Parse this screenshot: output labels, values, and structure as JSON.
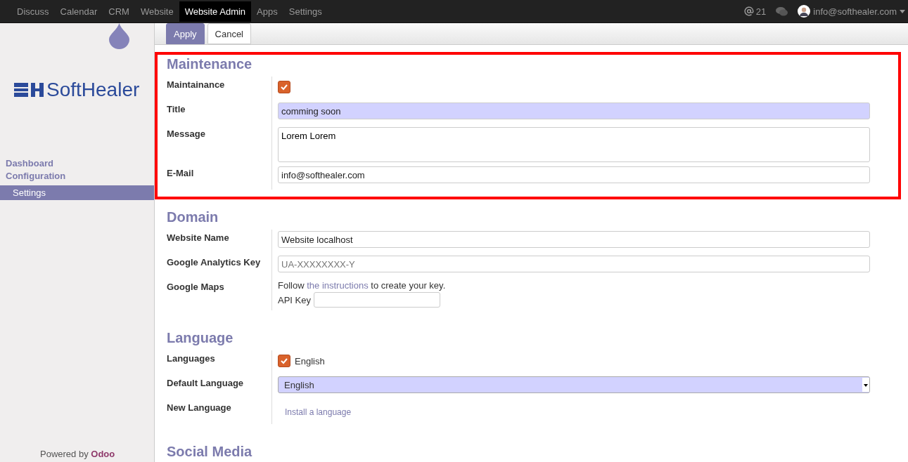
{
  "topbar": {
    "apps": [
      {
        "label": "Discuss",
        "selected": false
      },
      {
        "label": "Calendar",
        "selected": false
      },
      {
        "label": "CRM",
        "selected": false
      },
      {
        "label": "Website",
        "selected": false
      },
      {
        "label": "Website Admin",
        "selected": true
      },
      {
        "label": "Apps",
        "selected": false
      },
      {
        "label": "Settings",
        "selected": false
      }
    ],
    "mentions": "21",
    "user": "info@softhealer.com"
  },
  "sidebar": {
    "logo_text": "SoftHealer",
    "section": [
      "Dashboard",
      "Configuration"
    ],
    "items": [
      {
        "label": "Settings",
        "selected": true
      }
    ],
    "footer": {
      "text": "Powered by",
      "link": "Odoo"
    }
  },
  "toolbar": {
    "buttons": [
      {
        "label": "Apply",
        "kind": "primary"
      },
      {
        "label": "Cancel",
        "kind": "secondary"
      }
    ]
  },
  "sections": [
    {
      "title": "Maintenance",
      "highlighted": true,
      "fields": [
        {
          "label": "Maintainance",
          "kind": "checkbox",
          "checked": true
        },
        {
          "label": "Title",
          "kind": "input",
          "value": "comming soon",
          "required": true
        },
        {
          "label": "Message",
          "kind": "textarea",
          "value": "Lorem Lorem"
        },
        {
          "label": "E-Mail",
          "kind": "input",
          "value": "info@softhealer.com",
          "required": false
        }
      ]
    },
    {
      "title": "Domain",
      "highlighted": false,
      "fields": [
        {
          "label": "Website Name",
          "kind": "input",
          "value": "Website localhost",
          "required": false
        },
        {
          "label": "Google Analytics Key",
          "kind": "input",
          "placeholder": "UA-XXXXXXXX-Y",
          "required": false
        },
        {
          "label": "Google Maps",
          "kind": "maps",
          "before": "Follow",
          "link": "the instructions",
          "after": "to create your key.",
          "api_label": "API Key"
        }
      ]
    },
    {
      "title": "Language",
      "highlighted": false,
      "fields": [
        {
          "label": "Languages",
          "kind": "checkbox",
          "checked": true,
          "text": "English"
        },
        {
          "label": "Default Language",
          "kind": "select",
          "value": "English"
        },
        {
          "label": "New Language",
          "kind": "link",
          "text": "Install a language"
        }
      ]
    },
    {
      "title": "Social Media",
      "highlighted": false
    }
  ]
}
